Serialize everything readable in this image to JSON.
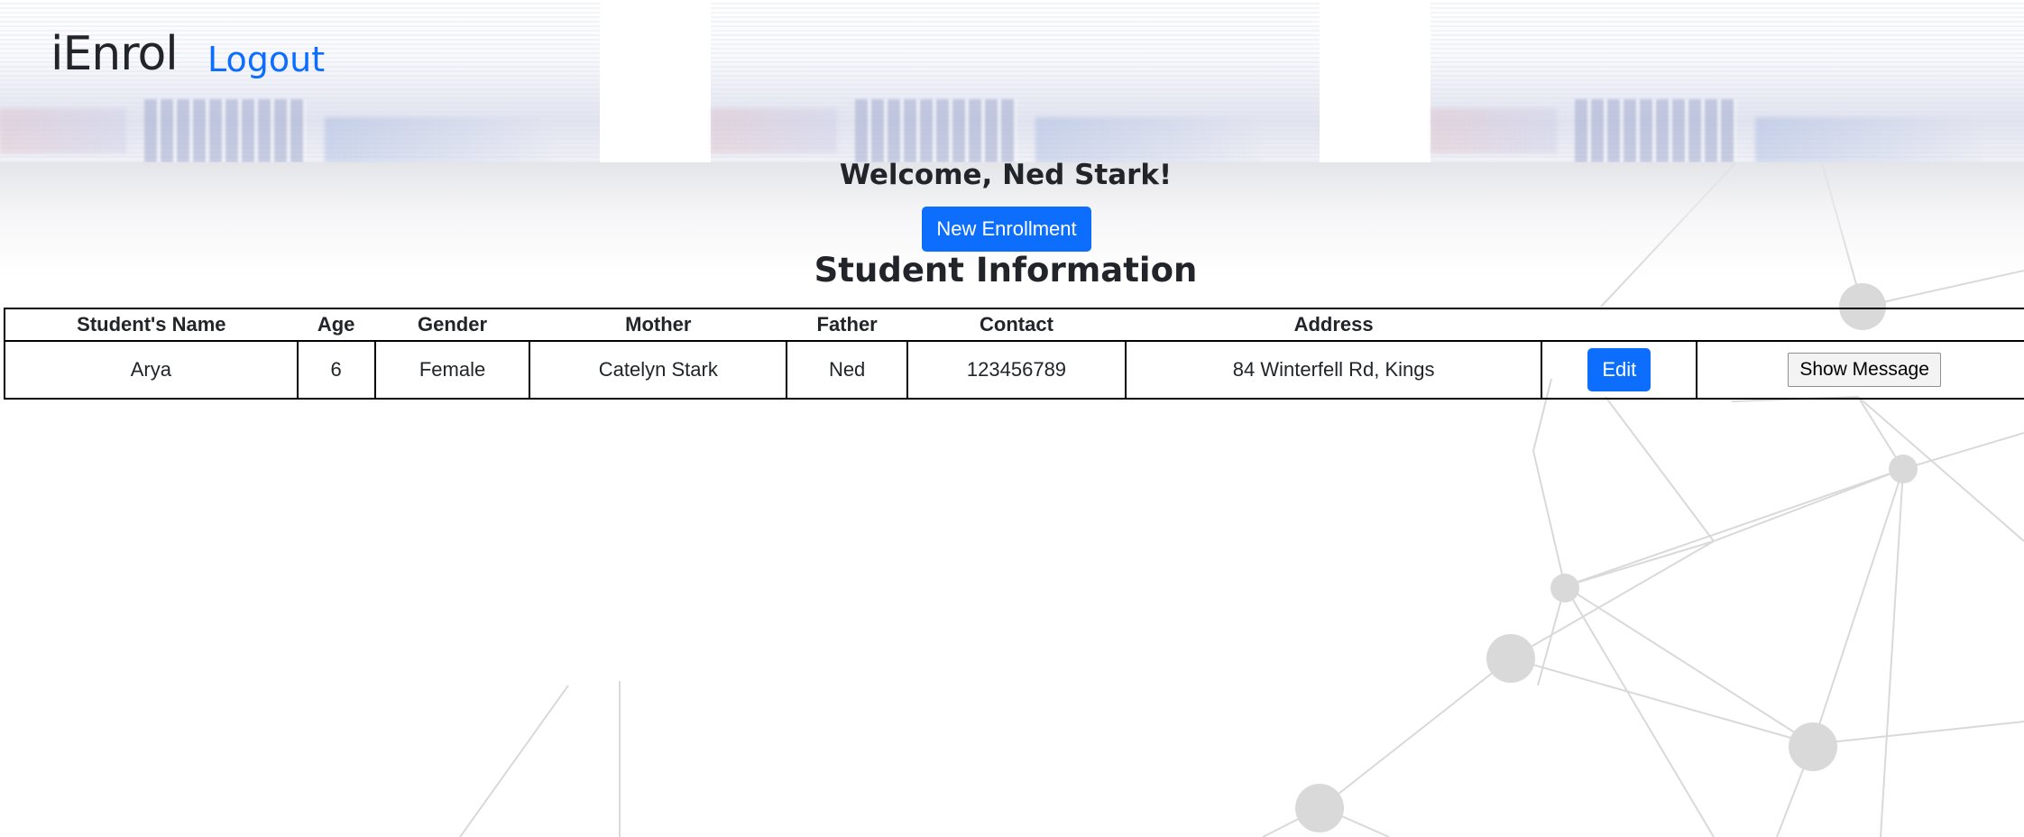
{
  "header": {
    "brand": "iEnrol",
    "logout_label": "Logout"
  },
  "main": {
    "welcome": "Welcome, Ned Stark!",
    "new_enrollment_label": "New Enrollment",
    "section_title": "Student Information"
  },
  "table": {
    "columns": [
      "Student's Name",
      "Age",
      "Gender",
      "Mother",
      "Father",
      "Contact",
      "Address",
      "",
      ""
    ],
    "rows": [
      {
        "name": "Arya",
        "age": "6",
        "gender": "Female",
        "mother": "Catelyn Stark",
        "father": "Ned",
        "contact": "123456789",
        "address": "84 Winterfell Rd, Kings",
        "edit_label": "Edit",
        "message_label": "Show Message"
      }
    ]
  },
  "colors": {
    "accent": "#0d6efd",
    "text": "#212529"
  }
}
